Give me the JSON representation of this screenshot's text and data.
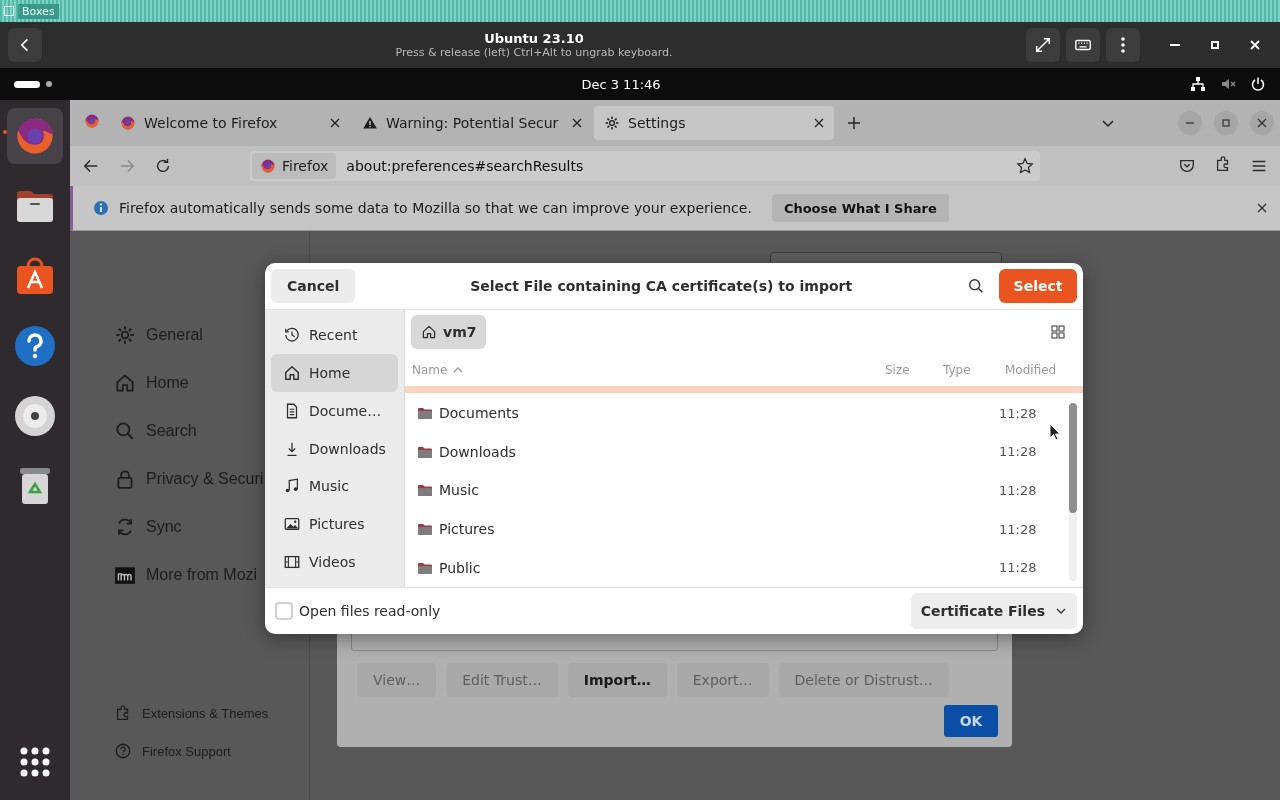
{
  "app_window": {
    "title": "Boxes"
  },
  "vm_header": {
    "title": "Ubuntu 23.10",
    "subtitle": "Press & release (left) Ctrl+Alt to ungrab keyboard."
  },
  "top_bar": {
    "clock": "Dec 3  11:46"
  },
  "dock": {
    "items": [
      {
        "kind": "firefox",
        "running": true
      },
      {
        "kind": "files",
        "running": false
      },
      {
        "kind": "store",
        "running": false
      },
      {
        "kind": "help",
        "running": false
      },
      {
        "kind": "disc",
        "running": false
      },
      {
        "kind": "trash",
        "running": false
      }
    ]
  },
  "browser": {
    "tabs": [
      {
        "title": "Welcome to Firefox",
        "selected": false
      },
      {
        "title": "Warning: Potential Secur",
        "selected": false
      },
      {
        "title": "Settings",
        "selected": true
      }
    ],
    "identity": "Firefox",
    "url": "about:preferences#searchResults",
    "notification": {
      "message": "Firefox automatically sends some data to Mozilla so that we can improve your experience.",
      "button": "Choose What I Share"
    }
  },
  "settings": {
    "nav": [
      {
        "label": "General"
      },
      {
        "label": "Home"
      },
      {
        "label": "Search"
      },
      {
        "label": "Privacy & Securi"
      },
      {
        "label": "Sync"
      },
      {
        "label": "More from Mozi"
      }
    ],
    "footer_links": [
      {
        "label": "Extensions & Themes"
      },
      {
        "label": "Firefox Support"
      }
    ]
  },
  "certificate_manager": {
    "buttons": [
      {
        "label": "View…",
        "disabled": true
      },
      {
        "label": "Edit Trust…",
        "disabled": true
      },
      {
        "label": "Import…",
        "disabled": false
      },
      {
        "label": "Export…",
        "disabled": true
      },
      {
        "label": "Delete or Distrust…",
        "disabled": true
      }
    ],
    "ok": "OK"
  },
  "file_dialog": {
    "cancel": "Cancel",
    "title": "Select File containing CA certificate(s) to import",
    "select": "Select",
    "places": [
      {
        "label": "Recent",
        "selected": false
      },
      {
        "label": "Home",
        "selected": true
      },
      {
        "label": "Docume…",
        "selected": false
      },
      {
        "label": "Downloads",
        "selected": false
      },
      {
        "label": "Music",
        "selected": false
      },
      {
        "label": "Pictures",
        "selected": false
      },
      {
        "label": "Videos",
        "selected": false
      }
    ],
    "path": "vm7",
    "columns": [
      "Name",
      "Size",
      "Type",
      "Modified"
    ],
    "files": [
      {
        "name": "Documents",
        "modified": "11:28"
      },
      {
        "name": "Downloads",
        "modified": "11:28"
      },
      {
        "name": "Music",
        "modified": "11:28"
      },
      {
        "name": "Pictures",
        "modified": "11:28"
      },
      {
        "name": "Public",
        "modified": "11:28"
      }
    ],
    "read_only": {
      "label": "Open files read-only",
      "checked": false
    },
    "filter": "Certificate Files"
  }
}
